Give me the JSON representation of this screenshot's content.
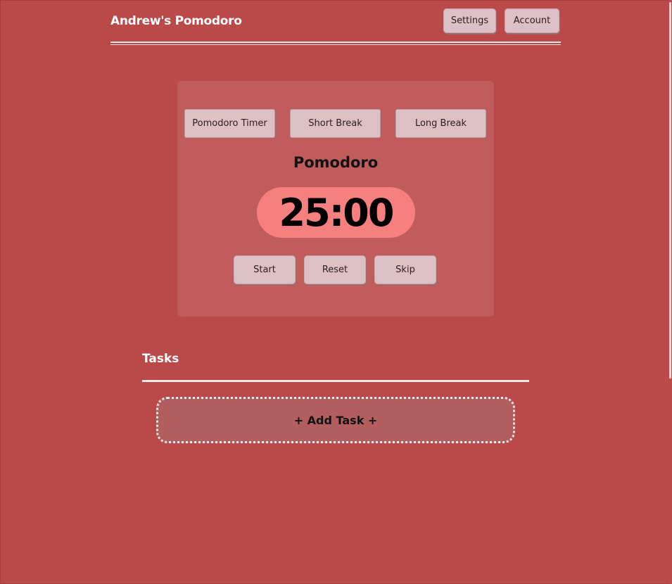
{
  "header": {
    "title": "Andrew's Pomodoro",
    "settings_label": "Settings",
    "account_label": "Account"
  },
  "timer": {
    "modes": [
      "Pomodoro Timer",
      "Short Break",
      "Long Break"
    ],
    "current_mode": "Pomodoro",
    "time": "25:00",
    "controls": {
      "start_label": "Start",
      "reset_label": "Reset",
      "skip_label": "Skip"
    }
  },
  "tasks": {
    "title": "Tasks",
    "add_label": "+ Add Task +"
  },
  "colors": {
    "background": "#ba4949",
    "card": "#c15c5c",
    "clock_pill": "#f67f7f",
    "button": "#dcc0c4"
  }
}
